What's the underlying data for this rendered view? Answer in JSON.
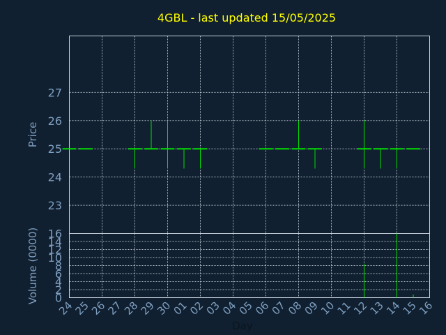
{
  "title": "4GBL - last updated 15/05/2025",
  "colors": {
    "background": "#102030",
    "title": "#ffff00",
    "axis_text": "#7f9fc0",
    "series": "#00e000",
    "grid": "#c8d2dc"
  },
  "chart_data": [
    {
      "type": "candlestick",
      "ylabel": "Price",
      "xlabel": "",
      "ylim": [
        22,
        29
      ],
      "yticks": [
        23,
        24,
        25,
        26,
        27
      ],
      "grid": true,
      "categories": [
        "24",
        "25",
        "26",
        "27",
        "28",
        "29",
        "30",
        "01",
        "02",
        "03",
        "04",
        "05",
        "06",
        "07",
        "08",
        "09",
        "10",
        "11",
        "12",
        "13",
        "14",
        "15",
        "16"
      ],
      "ohlc": [
        {
          "x": "24",
          "open": 25,
          "high": 25,
          "low": 25,
          "close": 25
        },
        {
          "x": "25",
          "open": 25,
          "high": 25,
          "low": 25,
          "close": 25
        },
        {
          "x": "28",
          "open": 25,
          "high": 25,
          "low": 24.3,
          "close": 25
        },
        {
          "x": "29",
          "open": 25,
          "high": 26,
          "low": 25,
          "close": 25
        },
        {
          "x": "30",
          "open": 25,
          "high": 26,
          "low": 24.3,
          "close": 25
        },
        {
          "x": "01",
          "open": 25,
          "high": 25,
          "low": 24.3,
          "close": 25
        },
        {
          "x": "02",
          "open": 25,
          "high": 25,
          "low": 24.3,
          "close": 25
        },
        {
          "x": "06",
          "open": 25,
          "high": 25,
          "low": 25,
          "close": 25
        },
        {
          "x": "07",
          "open": 25,
          "high": 25,
          "low": 25,
          "close": 25
        },
        {
          "x": "08",
          "open": 25,
          "high": 26,
          "low": 25,
          "close": 25
        },
        {
          "x": "09",
          "open": 25,
          "high": 25,
          "low": 24.3,
          "close": 25
        },
        {
          "x": "12",
          "open": 25,
          "high": 26,
          "low": 24.3,
          "close": 25
        },
        {
          "x": "13",
          "open": 25,
          "high": 25,
          "low": 24.3,
          "close": 25
        },
        {
          "x": "14",
          "open": 25,
          "high": 25,
          "low": 24.3,
          "close": 25
        },
        {
          "x": "15",
          "open": 25,
          "high": 25,
          "low": 25,
          "close": 25
        }
      ]
    },
    {
      "type": "bar",
      "ylabel": "Volume (0000)",
      "xlabel": "Day",
      "ylim": [
        0,
        16
      ],
      "yticks": [
        0,
        2,
        4,
        6,
        8,
        10,
        12,
        14,
        16
      ],
      "grid": true,
      "categories": [
        "24",
        "25",
        "26",
        "27",
        "28",
        "29",
        "30",
        "01",
        "02",
        "03",
        "04",
        "05",
        "06",
        "07",
        "08",
        "09",
        "10",
        "11",
        "12",
        "13",
        "14",
        "15",
        "16"
      ],
      "bars": [
        {
          "x": "12",
          "value": 8.5
        },
        {
          "x": "14",
          "value": 16
        },
        {
          "x": "15",
          "value": 0.8
        }
      ]
    }
  ]
}
